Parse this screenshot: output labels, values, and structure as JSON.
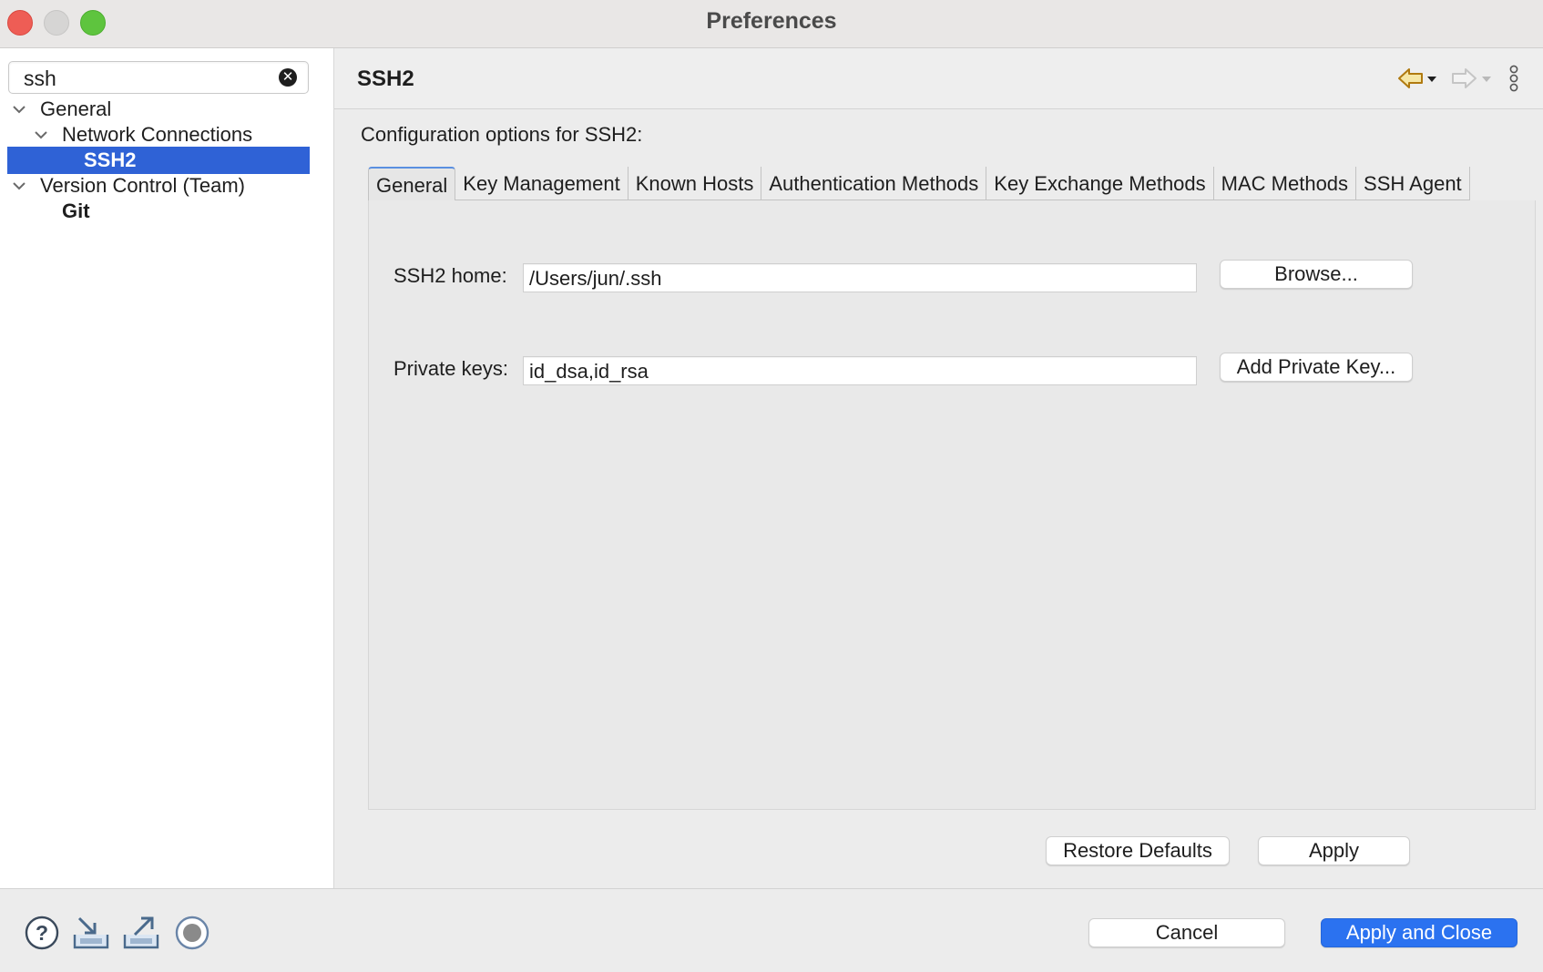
{
  "window": {
    "title": "Preferences"
  },
  "sidebar": {
    "search": {
      "value": "ssh",
      "placeholder": ""
    },
    "tree": [
      {
        "label": "General",
        "level": 0,
        "expanded": true
      },
      {
        "label": "Network Connections",
        "level": 1,
        "expanded": true
      },
      {
        "label": "SSH2",
        "level": 2,
        "selected": true
      },
      {
        "label": "Version Control (Team)",
        "level": 0,
        "expanded": true
      },
      {
        "label": "Git",
        "level": 1,
        "bold": true
      }
    ]
  },
  "header": {
    "title": "SSH2",
    "icons": [
      "back-arrow-icon",
      "forward-arrow-icon",
      "more-options-icon"
    ]
  },
  "main": {
    "description": "Configuration options for SSH2:",
    "tabs": [
      {
        "label": "General",
        "active": true
      },
      {
        "label": "Key Management"
      },
      {
        "label": "Known Hosts"
      },
      {
        "label": "Authentication Methods"
      },
      {
        "label": "Key Exchange Methods"
      },
      {
        "label": "MAC Methods"
      },
      {
        "label": "SSH Agent"
      }
    ],
    "ssh2_home": {
      "label": "SSH2 home:",
      "value": "/Users/jun/.ssh",
      "button": "Browse..."
    },
    "private_keys": {
      "label": "Private keys:",
      "value": "id_dsa,id_rsa",
      "button": "Add Private Key..."
    },
    "restore_defaults": "Restore Defaults",
    "apply": "Apply"
  },
  "footer": {
    "icons": [
      "help-icon",
      "import-icon",
      "export-icon",
      "record-icon"
    ],
    "cancel": "Cancel",
    "apply_close": "Apply and Close"
  },
  "colors": {
    "selection": "#2f62d6",
    "primary_button": "#2b72f0",
    "close": "#ee5d55",
    "maximize": "#5ec43e"
  }
}
